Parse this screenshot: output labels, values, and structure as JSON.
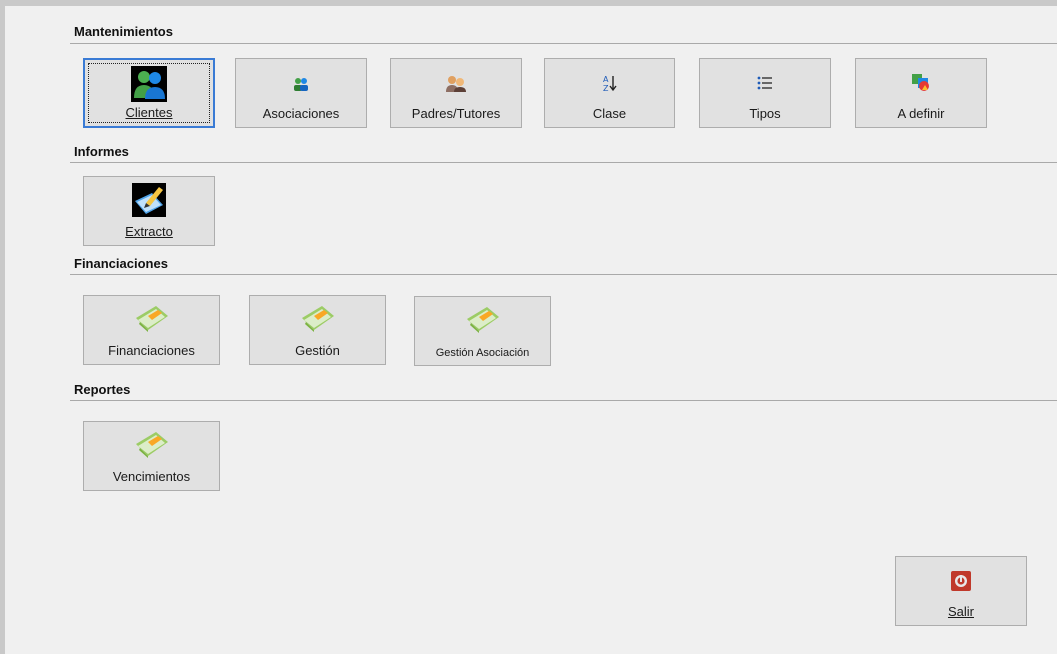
{
  "sections": {
    "mantenimientos": {
      "title": "Mantenimientos",
      "buttons": [
        {
          "label": "Clientes",
          "icon": "users-icon"
        },
        {
          "label": "Asociaciones",
          "icon": "association-icon"
        },
        {
          "label": "Padres/Tutores",
          "icon": "parents-icon"
        },
        {
          "label": "Clase",
          "icon": "sort-az-icon"
        },
        {
          "label": "Tipos",
          "icon": "list-icon"
        },
        {
          "label": "A definir",
          "icon": "shapes-icon"
        }
      ]
    },
    "informes": {
      "title": "Informes",
      "buttons": [
        {
          "label": "Extracto",
          "icon": "edit-document-icon"
        }
      ]
    },
    "financiaciones": {
      "title": "Financiaciones",
      "buttons": [
        {
          "label": "Financiaciones",
          "icon": "money-icon"
        },
        {
          "label": "Gestión",
          "icon": "money-icon"
        },
        {
          "label": "Gestión Asociación",
          "icon": "money-icon"
        }
      ]
    },
    "reportes": {
      "title": "Reportes",
      "buttons": [
        {
          "label": "Vencimientos",
          "icon": "money-icon"
        }
      ]
    }
  },
  "exit_button": {
    "label": "Salir",
    "icon": "power-icon"
  },
  "colors": {
    "background": "#f0f0f0",
    "button_face": "#e1e1e1",
    "focus_border": "#3a7bd5",
    "exit_icon": "#c0392b"
  }
}
